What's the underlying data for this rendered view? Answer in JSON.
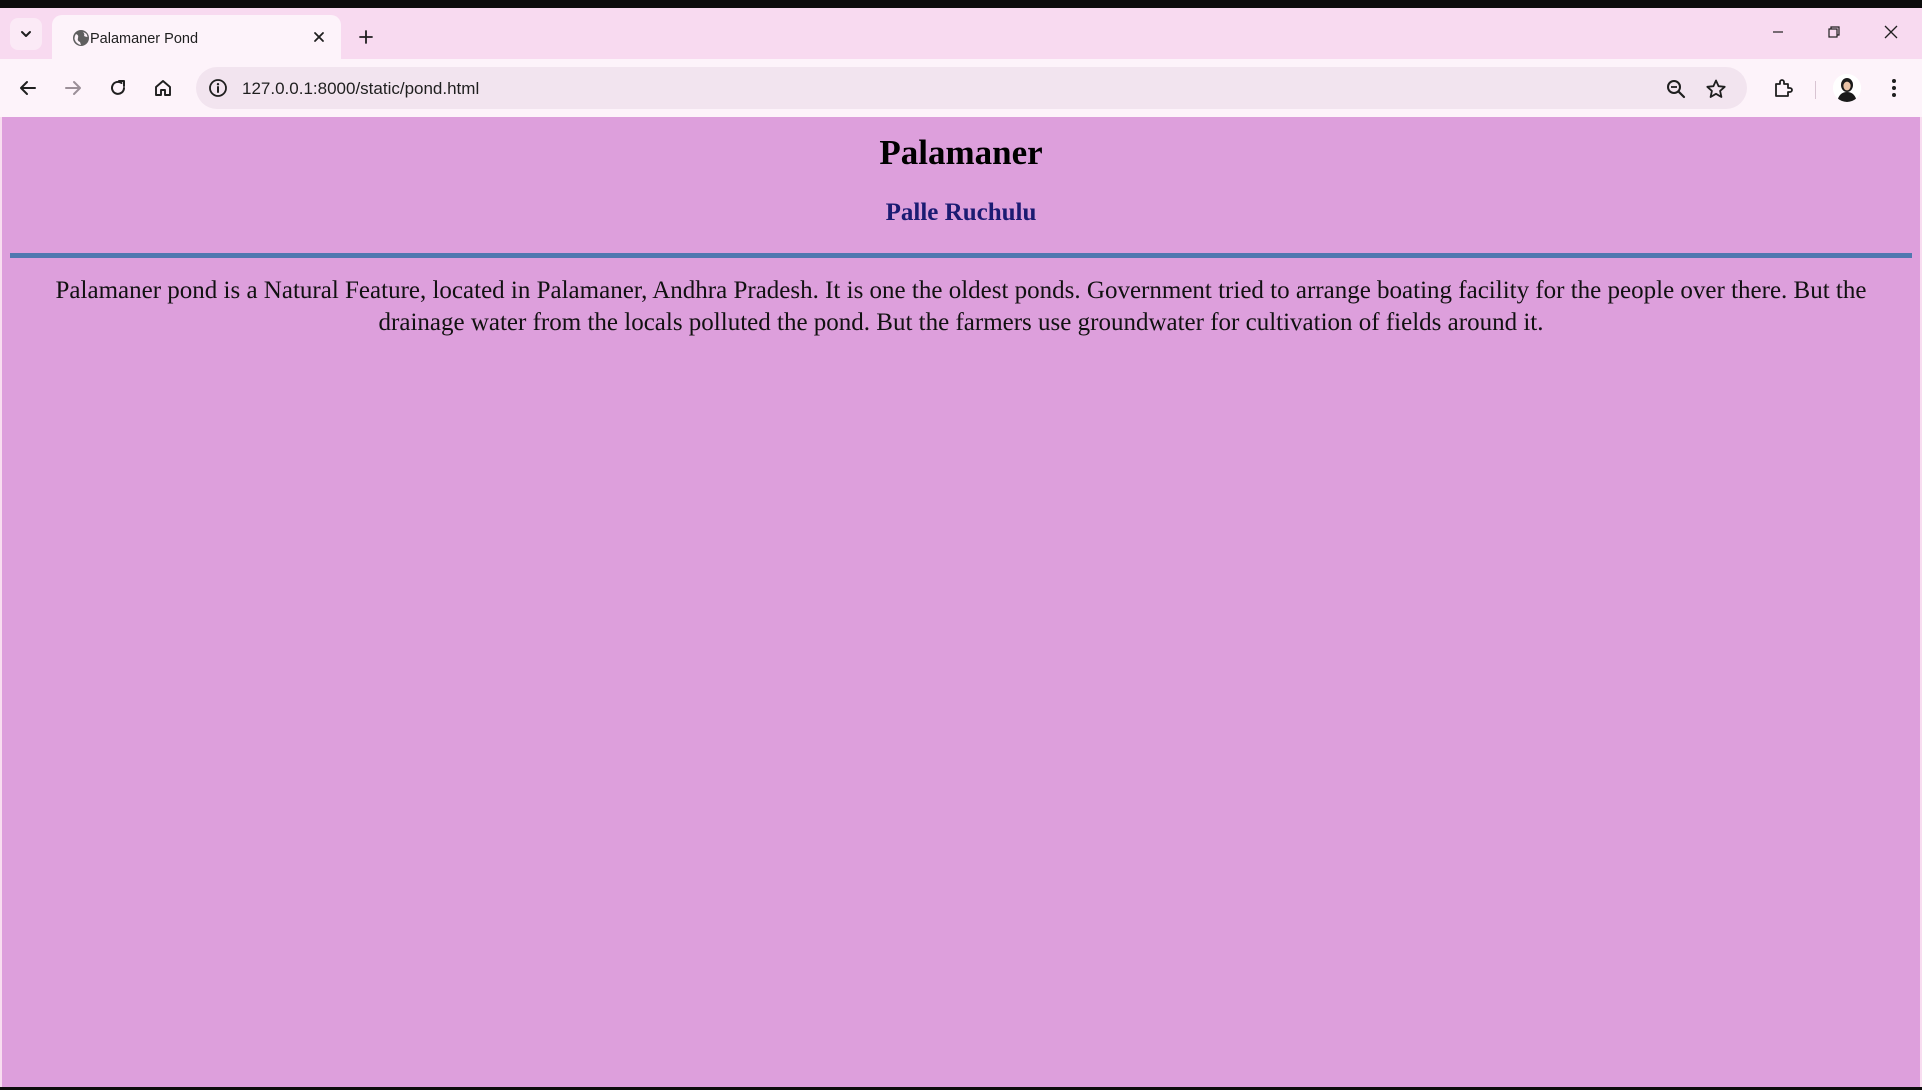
{
  "browser": {
    "tab": {
      "title": "Palamaner Pond",
      "favicon": "globe-icon"
    },
    "address_bar": {
      "url": "127.0.0.1:8000/static/pond.html",
      "info_icon": "info-icon"
    },
    "toolbar_icons": [
      "back-icon",
      "forward-icon",
      "reload-icon",
      "home-icon",
      "zoom-icon",
      "bookmark-star-icon",
      "extensions-icon",
      "profile-avatar",
      "more-menu-icon"
    ],
    "window_controls": [
      "minimize-icon",
      "restore-icon",
      "close-icon"
    ]
  },
  "page": {
    "title": "Palamaner",
    "subtitle": "Palle Ruchulu",
    "paragraph": "Palamaner pond is a Natural Feature, located in Palamaner, Andhra Pradesh. It is one the oldest ponds. Government tried to arrange boating facility for the people over there. But the drainage water from the locals polluted the pond. But the farmers use groundwater for cultivation of fields around it."
  },
  "colors": {
    "page_background": "#dd9fdc",
    "subtitle": "#1b1b72",
    "rule": "#4f78b0",
    "browser_frame": "#f8daf0"
  }
}
